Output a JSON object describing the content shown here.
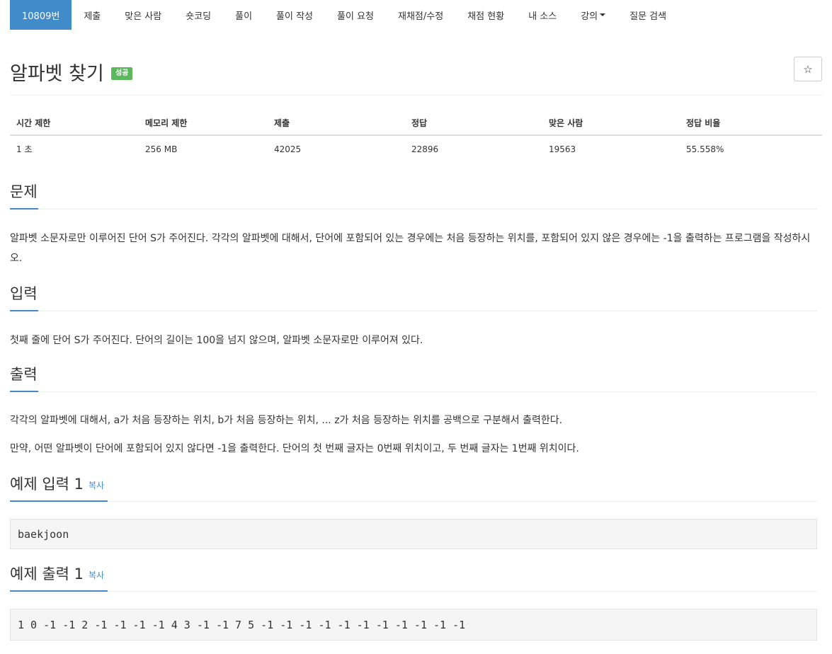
{
  "nav": {
    "items": [
      {
        "label": "10809번",
        "active": true
      },
      {
        "label": "제출"
      },
      {
        "label": "맞은 사람"
      },
      {
        "label": "숏코딩"
      },
      {
        "label": "풀이"
      },
      {
        "label": "풀이 작성"
      },
      {
        "label": "풀이 요청"
      },
      {
        "label": "재채점/수정"
      },
      {
        "label": "채점 현황"
      },
      {
        "label": "내 소스"
      },
      {
        "label": "강의",
        "dropdown": true
      },
      {
        "label": "질문 검색"
      }
    ]
  },
  "problem": {
    "title": "알파벳 찾기",
    "badge": "성공",
    "star_icon": "☆"
  },
  "stats": {
    "headers": [
      "시간 제한",
      "메모리 제한",
      "제출",
      "정답",
      "맞은 사람",
      "정답 비율"
    ],
    "values": [
      "1 초",
      "256 MB",
      "42025",
      "22896",
      "19563",
      "55.558%"
    ]
  },
  "sections": {
    "description": {
      "heading": "문제",
      "text": "알파벳 소문자로만 이루어진 단어 S가 주어진다. 각각의 알파벳에 대해서, 단어에 포함되어 있는 경우에는 처음 등장하는 위치를, 포함되어 있지 않은 경우에는 -1을 출력하는 프로그램을 작성하시오."
    },
    "input": {
      "heading": "입력",
      "text": "첫째 줄에 단어 S가 주어진다. 단어의 길이는 100을 넘지 않으며, 알파벳 소문자로만 이루어져 있다."
    },
    "output": {
      "heading": "출력",
      "lines": [
        "각각의 알파벳에 대해서, a가 처음 등장하는 위치, b가 처음 등장하는 위치, ... z가 처음 등장하는 위치를 공백으로 구분해서 출력한다.",
        "만약, 어떤 알파벳이 단어에 포함되어 있지 않다면 -1을 출력한다. 단어의 첫 번째 글자는 0번째 위치이고, 두 번째 글자는 1번째 위치이다."
      ]
    },
    "sample_input": {
      "heading": "예제 입력 1",
      "copy": "복사",
      "value": "baekjoon"
    },
    "sample_output": {
      "heading": "예제 출력 1",
      "copy": "복사",
      "value": "1 0 -1 -1 2 -1 -1 -1 -1 4 3 -1 -1 7 5 -1 -1 -1 -1 -1 -1 -1 -1 -1 -1 -1"
    }
  },
  "colors": {
    "accent": "#428bca",
    "success": "#5cb85c"
  }
}
